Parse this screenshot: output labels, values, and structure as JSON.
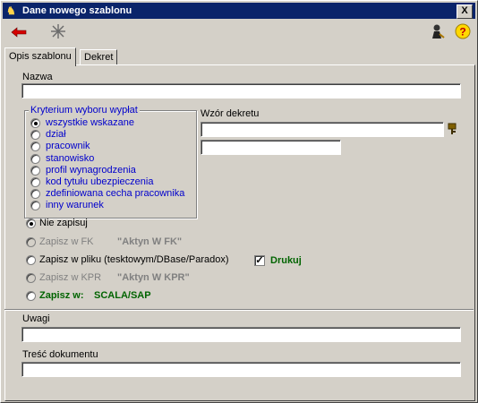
{
  "window": {
    "title": "Dane nowego szablonu",
    "close_label": "X"
  },
  "toolbar": {
    "back_icon": "back-arrow-icon",
    "sparkle_icon": "sparkle-icon",
    "user_icon": "user-icon",
    "help_icon": "help-icon"
  },
  "tabs": [
    {
      "label": "Opis szablonu"
    },
    {
      "label": "Dekret"
    }
  ],
  "nazwa": {
    "label": "Nazwa",
    "value": ""
  },
  "kryterium": {
    "legend": "Kryterium wyboru wypłat",
    "options": [
      {
        "label": "wszystkie wskazane",
        "checked": true
      },
      {
        "label": "dział"
      },
      {
        "label": "pracownik"
      },
      {
        "label": "stanowisko"
      },
      {
        "label": "profil wynagrodzenia"
      },
      {
        "label": "kod tytułu ubezpieczenia"
      },
      {
        "label": "zdefiniowana cecha pracownika"
      },
      {
        "label": "inny warunek"
      }
    ]
  },
  "wzor": {
    "label": "Wzór dekretu",
    "value1": "",
    "value2": ""
  },
  "save": {
    "nie_zapisuj": "Nie zapisuj",
    "fk": "Zapisz w FK",
    "fk_note": "\"Aktyn W FK\"",
    "plik": "Zapisz w pliku (tesktowym/DBase/Paradox)",
    "drukuj": "Drukuj",
    "kpr": "Zapisz w KPR",
    "kpr_note": "\"Aktyn W KPR\"",
    "scala_prefix": "Zapisz w:",
    "scala": "SCALA/SAP"
  },
  "uwagi": {
    "label": "Uwagi",
    "value": ""
  },
  "tresc": {
    "label": "Treść dokumentu",
    "value": ""
  }
}
